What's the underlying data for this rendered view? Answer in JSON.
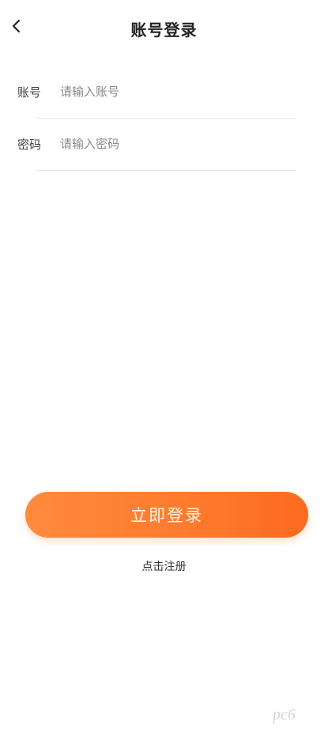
{
  "header": {
    "title": "账号登录",
    "back_icon": "chevron-left-icon"
  },
  "form": {
    "account": {
      "label": "账号",
      "placeholder": "请输入账号",
      "value": ""
    },
    "password": {
      "label": "密码",
      "placeholder": "请输入密码",
      "value": ""
    }
  },
  "actions": {
    "login_label": "立即登录",
    "register_label": "点击注册"
  },
  "watermark": {
    "text": "pc6"
  },
  "colors": {
    "accent_start": "#ff8a3d",
    "accent_end": "#fb6a1f",
    "divider": "#e6e6e6"
  }
}
